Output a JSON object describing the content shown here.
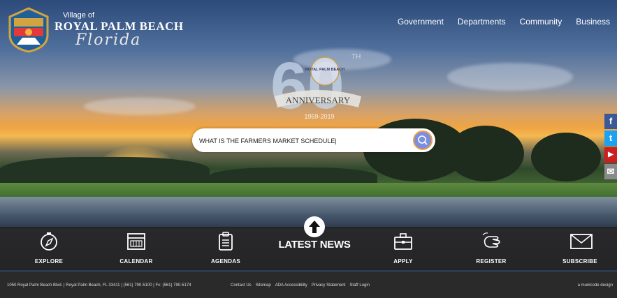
{
  "brand": {
    "village": "Village of",
    "name": "ROYAL PALM BEACH",
    "state": "Florida"
  },
  "nav": [
    "Government",
    "Departments",
    "Community",
    "Business"
  ],
  "emblem": {
    "number": "60",
    "th": "TH",
    "seal": "ROYAL PALM BEACH",
    "banner": "ANNIVERSARY",
    "years": "1959-2019"
  },
  "search": {
    "value": "WHAT IS THE FARMERS MARKET SCHEDULE|"
  },
  "social": [
    {
      "icon": "facebook-icon",
      "glyph": "f",
      "color": "#3b5998"
    },
    {
      "icon": "twitter-icon",
      "glyph": "t",
      "color": "#1da1f2"
    },
    {
      "icon": "youtube-icon",
      "glyph": "▶",
      "color": "#cc1f1f"
    },
    {
      "icon": "email-icon",
      "glyph": "✉",
      "color": "#8a8a8a"
    }
  ],
  "quicklinks": {
    "explore": "EXPLORE",
    "calendar": "CALENDAR",
    "agendas": "AGENDAS",
    "latest_news": "LATEST NEWS",
    "apply": "APPLY",
    "register": "REGISTER",
    "subscribe": "SUBSCRIBE"
  },
  "footer": {
    "address": "1050 Royal Palm Beach Blvd. | Royal Palm Beach, FL 33411 | (561) 790-5100 | Fx: (561) 790-5174",
    "links": [
      "Contact Us",
      "Sitemap",
      "ADA Accessibility",
      "Privacy Statement",
      "Staff Login"
    ],
    "credit": "a municode design"
  },
  "colors": {
    "search_button": "#7a8fe0",
    "search_ring": "#f0a040",
    "bar": "#23201e"
  }
}
